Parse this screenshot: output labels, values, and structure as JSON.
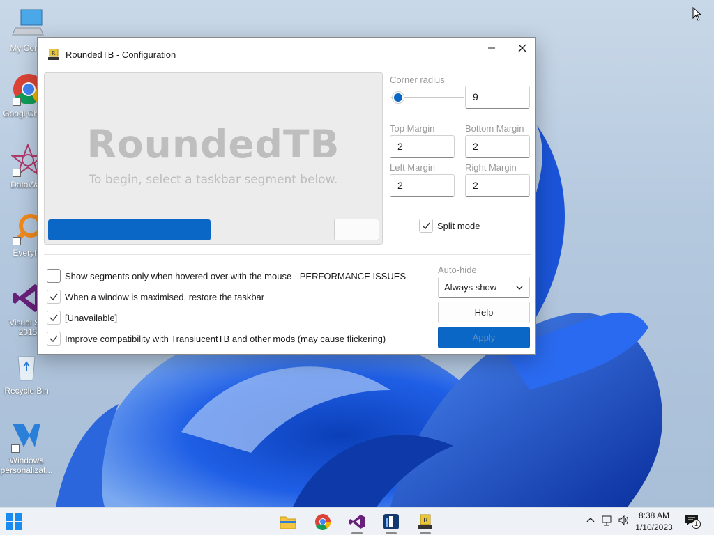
{
  "desktop": {
    "icons": [
      {
        "label": "My Comp"
      },
      {
        "label": "Googl Chrom"
      },
      {
        "label": "DataWag"
      },
      {
        "label": "Everythi"
      },
      {
        "label": "Visual Stu 2015"
      },
      {
        "label": "Recycle Bin"
      },
      {
        "label": "Windows personalizat..."
      }
    ]
  },
  "window": {
    "title": "RoundedTB - Configuration",
    "preview": {
      "heading": "RoundedTB",
      "subtext": "To begin, select a taskbar segment below."
    },
    "corner_radius": {
      "label": "Corner radius",
      "value": "9",
      "slider_level": 0.1
    },
    "margins": {
      "top_label": "Top Margin",
      "top_value": "2",
      "bottom_label": "Bottom Margin",
      "bottom_value": "2",
      "left_label": "Left Margin",
      "left_value": "2",
      "right_label": "Right Margin",
      "right_value": "2"
    },
    "split_mode": {
      "label": "Split mode",
      "checked": true
    },
    "options": [
      {
        "label": "Show segments only when hovered over with the mouse - PERFORMANCE ISSUES",
        "checked": false
      },
      {
        "label": "When a window is maximised, restore the taskbar",
        "checked": true
      },
      {
        "label": "[Unavailable]",
        "checked": true
      },
      {
        "label": "Improve compatibility with TranslucentTB and other mods (may cause flickering)",
        "checked": true
      }
    ],
    "auto_hide": {
      "label": "Auto-hide",
      "selected": "Always show"
    },
    "help_label": "Help",
    "apply_label": "Apply"
  },
  "taskbar": {
    "apps": [
      "file-explorer",
      "google-chrome",
      "visual-studio",
      "app-blue-tile",
      "roundedtb"
    ],
    "clock": {
      "time": "8:38 AM",
      "date": "1/10/2023"
    },
    "notification_count": "1"
  },
  "colors": {
    "accent": "#0a67c6",
    "window_bg": "#ffffff",
    "taskbar_bg": "#eef2f7"
  }
}
